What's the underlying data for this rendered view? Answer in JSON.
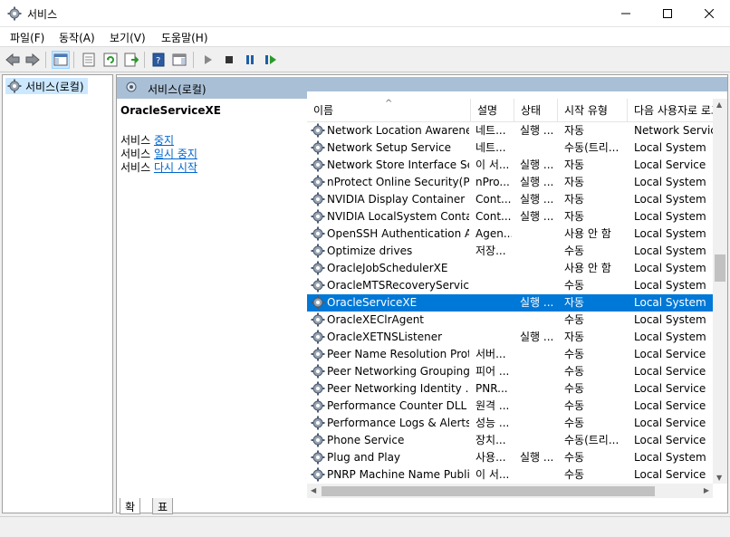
{
  "window": {
    "title": "서비스"
  },
  "menu": [
    "파일(F)",
    "동작(A)",
    "보기(V)",
    "도움말(H)"
  ],
  "tree": {
    "root_label": "서비스(로컬)"
  },
  "pane": {
    "header_title": "서비스(로컬)"
  },
  "description": {
    "service_name": "OracleServiceXE",
    "actions": [
      {
        "prefix": "서비스",
        "link": "중지"
      },
      {
        "prefix": "서비스",
        "link": "일시 중지"
      },
      {
        "prefix": "서비스",
        "link": "다시 시작"
      }
    ]
  },
  "columns": [
    "이름",
    "설명",
    "상태",
    "시작 유형",
    "다음 사용자로 로그온"
  ],
  "services": [
    {
      "name": "Network Location Awareness",
      "desc": "네트...",
      "status": "실행 ...",
      "startup": "자동",
      "logon": "Network Service",
      "selected": false
    },
    {
      "name": "Network Setup Service",
      "desc": "네트...",
      "status": "",
      "startup": "수동(트리...",
      "logon": "Local System",
      "selected": false
    },
    {
      "name": "Network Store Interface Se...",
      "desc": "이 서...",
      "status": "실행 ...",
      "startup": "자동",
      "logon": "Local Service",
      "selected": false
    },
    {
      "name": "nProtect Online Security(P...",
      "desc": "nPro...",
      "status": "실행 ...",
      "startup": "자동",
      "logon": "Local System",
      "selected": false
    },
    {
      "name": "NVIDIA Display Container LS",
      "desc": "Cont...",
      "status": "실행 ...",
      "startup": "자동",
      "logon": "Local System",
      "selected": false
    },
    {
      "name": "NVIDIA LocalSystem Conta...",
      "desc": "Cont...",
      "status": "실행 ...",
      "startup": "자동",
      "logon": "Local System",
      "selected": false
    },
    {
      "name": "OpenSSH Authentication A...",
      "desc": "Agen...",
      "status": "",
      "startup": "사용 안 함",
      "logon": "Local System",
      "selected": false
    },
    {
      "name": "Optimize drives",
      "desc": "저장...",
      "status": "",
      "startup": "수동",
      "logon": "Local System",
      "selected": false
    },
    {
      "name": "OracleJobSchedulerXE",
      "desc": "",
      "status": "",
      "startup": "사용 안 함",
      "logon": "Local System",
      "selected": false
    },
    {
      "name": "OracleMTSRecoveryService",
      "desc": "",
      "status": "",
      "startup": "수동",
      "logon": "Local System",
      "selected": false
    },
    {
      "name": "OracleServiceXE",
      "desc": "",
      "status": "실행 ...",
      "startup": "자동",
      "logon": "Local System",
      "selected": true
    },
    {
      "name": "OracleXEClrAgent",
      "desc": "",
      "status": "",
      "startup": "수동",
      "logon": "Local System",
      "selected": false
    },
    {
      "name": "OracleXETNSListener",
      "desc": "",
      "status": "실행 ...",
      "startup": "자동",
      "logon": "Local System",
      "selected": false
    },
    {
      "name": "Peer Name Resolution Prot...",
      "desc": "서버...",
      "status": "",
      "startup": "수동",
      "logon": "Local Service",
      "selected": false
    },
    {
      "name": "Peer Networking Grouping",
      "desc": "피어 ...",
      "status": "",
      "startup": "수동",
      "logon": "Local Service",
      "selected": false
    },
    {
      "name": "Peer Networking Identity ...",
      "desc": "PNR...",
      "status": "",
      "startup": "수동",
      "logon": "Local Service",
      "selected": false
    },
    {
      "name": "Performance Counter DLL ...",
      "desc": "원격 ...",
      "status": "",
      "startup": "수동",
      "logon": "Local Service",
      "selected": false
    },
    {
      "name": "Performance Logs & Alerts",
      "desc": "성능 ...",
      "status": "",
      "startup": "수동",
      "logon": "Local Service",
      "selected": false
    },
    {
      "name": "Phone Service",
      "desc": "장치...",
      "status": "",
      "startup": "수동(트리...",
      "logon": "Local Service",
      "selected": false
    },
    {
      "name": "Plug and Play",
      "desc": "사용...",
      "status": "실행 ...",
      "startup": "수동",
      "logon": "Local System",
      "selected": false
    },
    {
      "name": "PNRP Machine Name Publi...",
      "desc": "이 서...",
      "status": "",
      "startup": "수동",
      "logon": "Local Service",
      "selected": false
    }
  ],
  "tabs": [
    "확장",
    "표준"
  ],
  "colors": {
    "selection": "#0078d7",
    "pane_header": "#a9bfd6",
    "link": "#0066cc"
  }
}
